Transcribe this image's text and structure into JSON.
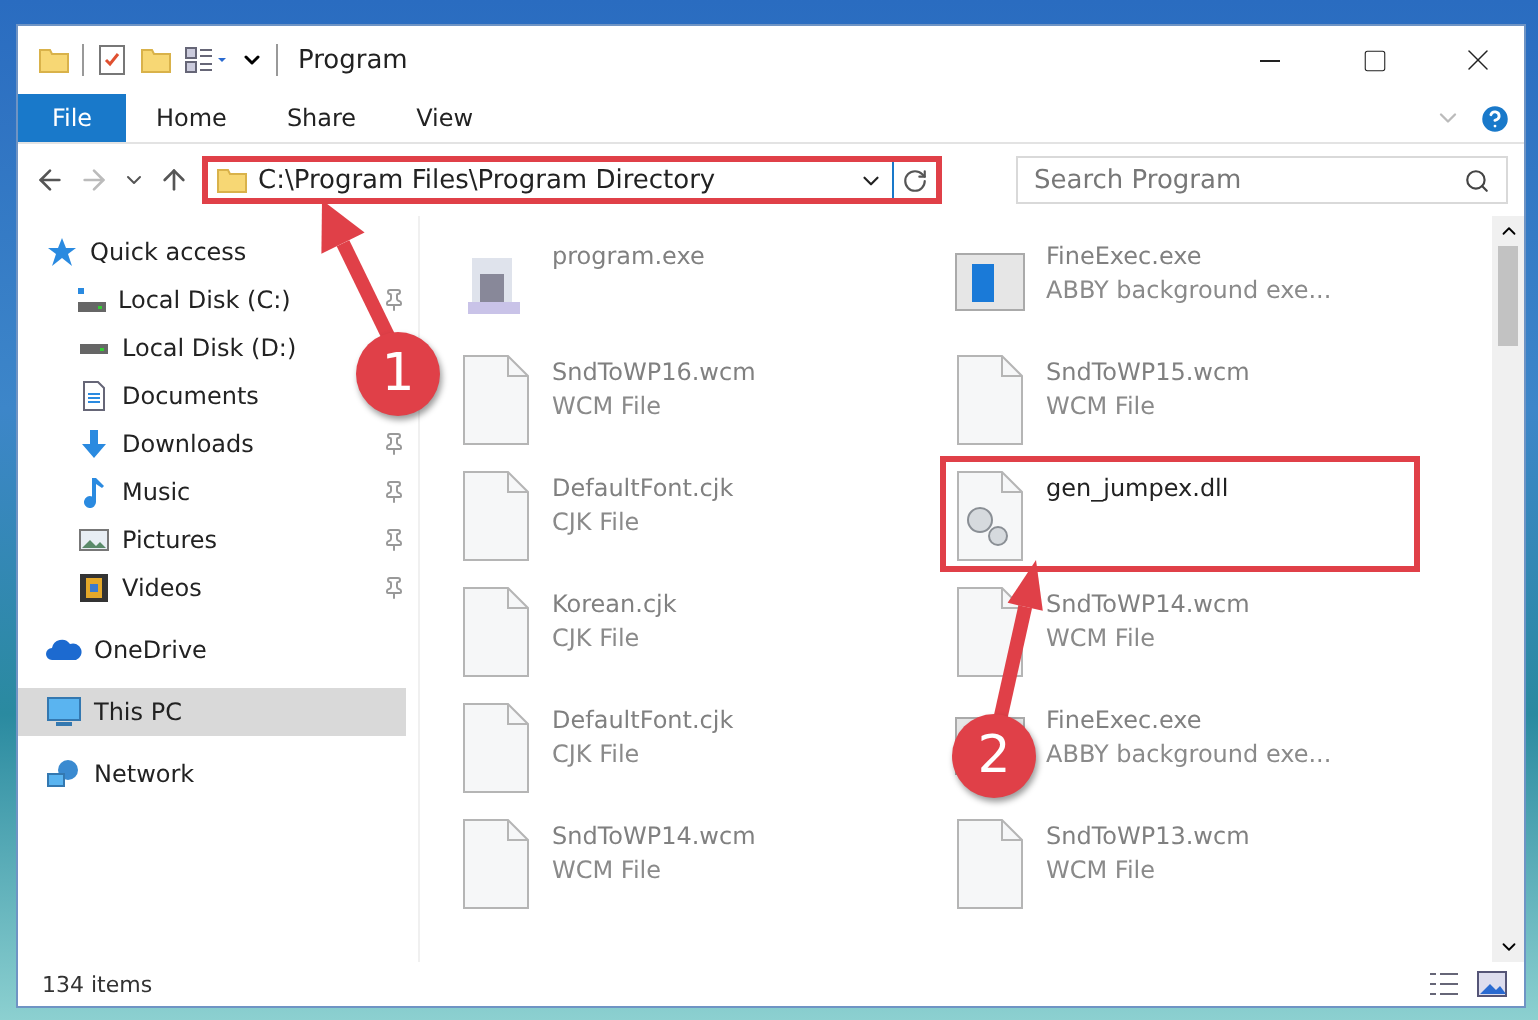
{
  "window": {
    "title": "Program"
  },
  "ribbon": {
    "tabs": [
      {
        "label": "File",
        "kind": "file"
      },
      {
        "label": "Home",
        "kind": "tab"
      },
      {
        "label": "Share",
        "kind": "tab"
      },
      {
        "label": "View",
        "kind": "tab"
      }
    ]
  },
  "address_bar": {
    "path": "C:\\Program Files\\Program Directory",
    "highlighted": true
  },
  "search": {
    "placeholder": "Search Program"
  },
  "sidebar": {
    "items": [
      {
        "label": "Quick access",
        "kind": "star",
        "selected": false,
        "children": [
          {
            "label": "Local Disk (C:)",
            "kind": "drive-c",
            "pinned": true,
            "selected": false
          },
          {
            "label": "Local Disk (D:)",
            "kind": "drive",
            "selected": false
          },
          {
            "label": "Documents",
            "kind": "documents",
            "selected": false
          },
          {
            "label": "Downloads",
            "kind": "downloads",
            "pinned": true,
            "selected": false
          },
          {
            "label": "Music",
            "kind": "music",
            "pinned": true,
            "selected": false
          },
          {
            "label": "Pictures",
            "kind": "pictures",
            "pinned": true,
            "selected": false
          },
          {
            "label": "Videos",
            "kind": "videos",
            "pinned": true,
            "selected": false
          }
        ]
      },
      {
        "label": "OneDrive",
        "kind": "cloud",
        "selected": false
      },
      {
        "label": "This PC",
        "kind": "pc",
        "selected": true
      },
      {
        "label": "Network",
        "kind": "network",
        "selected": false
      }
    ]
  },
  "files": [
    {
      "name": "program.exe",
      "kind": "installer",
      "blurred": true,
      "highlighted": false
    },
    {
      "name": "FineExec.exe",
      "type": "ABBY background exe...",
      "kind": "app",
      "blurred": true,
      "highlighted": false
    },
    {
      "name": "SndToWP16.wcm",
      "type": "WCM File",
      "kind": "blank",
      "blurred": true,
      "highlighted": false
    },
    {
      "name": "SndToWP15.wcm",
      "type": "WCM File",
      "kind": "blank",
      "blurred": true,
      "highlighted": false
    },
    {
      "name": "DefaultFont.cjk",
      "type": "CJK File",
      "kind": "blank",
      "blurred": true,
      "highlighted": false
    },
    {
      "name": "gen_jumpex.dll",
      "kind": "dll",
      "blurred": false,
      "highlighted": true
    },
    {
      "name": "Korean.cjk",
      "type": "CJK File",
      "kind": "blank",
      "blurred": true,
      "highlighted": false
    },
    {
      "name": "SndToWP14.wcm",
      "type": "WCM File",
      "kind": "blank",
      "blurred": true,
      "highlighted": false
    },
    {
      "name": "DefaultFont.cjk",
      "type": "CJK File",
      "kind": "blank",
      "blurred": true,
      "highlighted": false
    },
    {
      "name": "FineExec.exe",
      "type": "ABBY background exe...",
      "kind": "app",
      "blurred": true,
      "highlighted": false
    },
    {
      "name": "SndToWP14.wcm",
      "type": "WCM File",
      "kind": "blank",
      "blurred": true,
      "highlighted": false
    },
    {
      "name": "SndToWP13.wcm",
      "type": "WCM File",
      "kind": "blank",
      "blurred": true,
      "highlighted": false
    }
  ],
  "status_bar": {
    "item_count": "134 items"
  },
  "annotations": [
    {
      "label": "1"
    },
    {
      "label": "2"
    }
  ]
}
